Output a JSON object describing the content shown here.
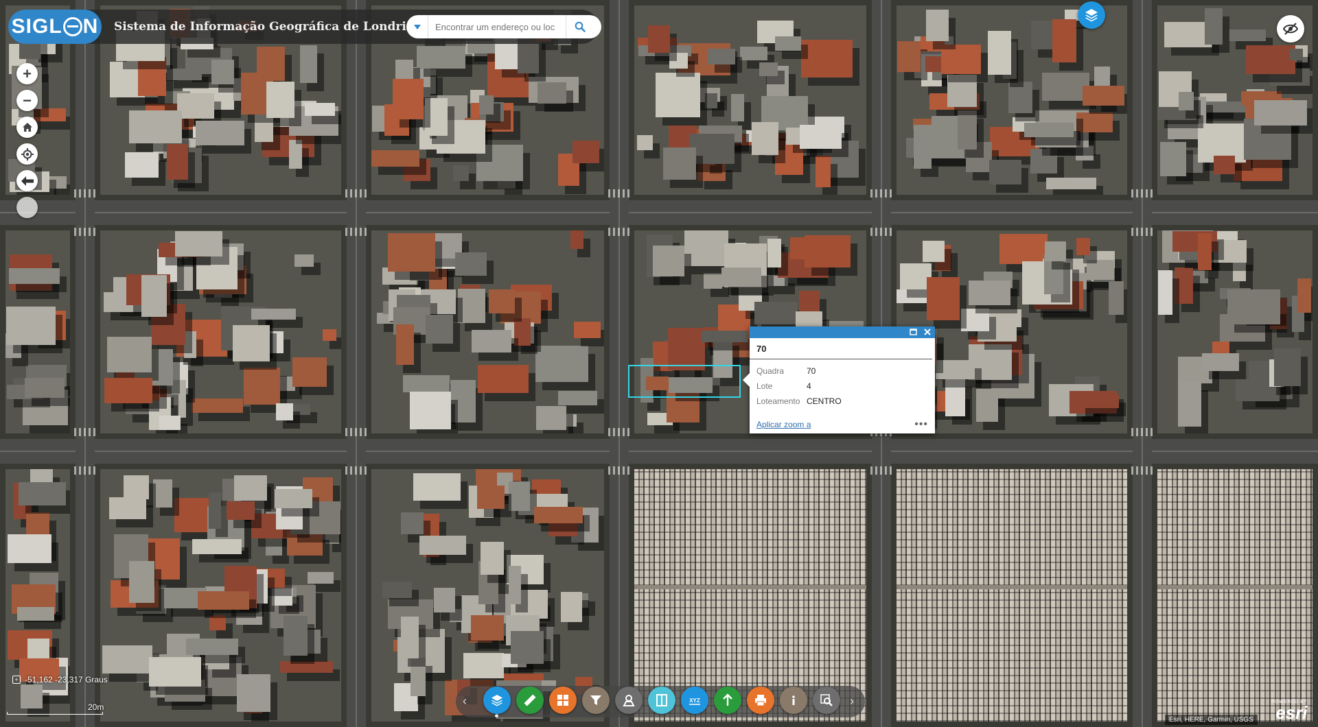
{
  "header": {
    "logo_text": "SIGL",
    "logo_text_end": "N",
    "title": "Sistema de Informação Geográfica de Londrina"
  },
  "search": {
    "placeholder": "Encontrar um endereço ou loc",
    "value": ""
  },
  "map_tools": [
    {
      "name": "zoom-in-button",
      "label": "+"
    },
    {
      "name": "zoom-out-button",
      "label": "−"
    },
    {
      "name": "home-button",
      "icon": "home-icon"
    },
    {
      "name": "locate-button",
      "icon": "locate-icon"
    },
    {
      "name": "previous-extent-button",
      "label": "🡄"
    },
    {
      "name": "next-extent-button",
      "label": "🡆"
    }
  ],
  "popup": {
    "title": "70",
    "fields": [
      {
        "key": "Quadra",
        "value": "70"
      },
      {
        "key": "Lote",
        "value": "4"
      },
      {
        "key": "Loteamento",
        "value": "CENTRO"
      }
    ],
    "zoom_link": "Aplicar zoom a",
    "more": "•••"
  },
  "coordinates": "-51,162 -23,317 Graus",
  "scale_label": "20m",
  "attribution": "Esri, HERE, Garmin, USGS",
  "esri": {
    "powered": "POWERED BY",
    "brand": "esri"
  },
  "toolbar": {
    "items": [
      {
        "name": "layers-tool",
        "icon": "layers-icon",
        "color": "#1f95df"
      },
      {
        "name": "measure-tool",
        "icon": "ruler-icon",
        "color": "#2a9c3c"
      },
      {
        "name": "basemap-tool",
        "icon": "grid-icon",
        "color": "#e8742c"
      },
      {
        "name": "filter-tool",
        "icon": "filter-icon",
        "color": "#8a7a6a"
      },
      {
        "name": "select-tool",
        "icon": "select-icon",
        "color": "#6e6e6e"
      },
      {
        "name": "swipe-tool",
        "icon": "swipe-icon",
        "color": "#4fc3d8"
      },
      {
        "name": "coordinates-tool",
        "icon": "xyz-icon",
        "label": "XYZ",
        "color": "#1f95df"
      },
      {
        "name": "share-tool",
        "icon": "share-icon",
        "color": "#2a9c3c"
      },
      {
        "name": "print-tool",
        "icon": "print-icon",
        "color": "#e8742c"
      },
      {
        "name": "about-tool",
        "icon": "info-icon",
        "label": "i",
        "color": "#8a7a6a"
      },
      {
        "name": "query-tool",
        "icon": "search-map-icon",
        "color": "#6e6e6e"
      }
    ],
    "prev": "‹",
    "next": "›"
  }
}
